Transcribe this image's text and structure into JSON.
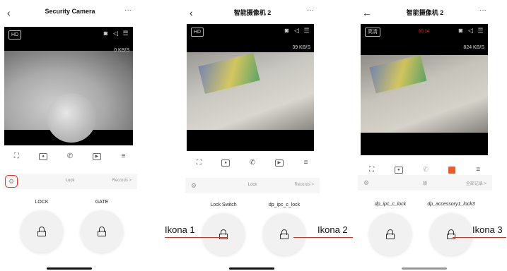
{
  "panels": [
    {
      "title": "Security Camera",
      "hd": "HD",
      "speed": "0 KB/S",
      "bar": {
        "lock": "Lock",
        "records": "Records >"
      },
      "left_button": "LOCK",
      "right_button": "GATE"
    },
    {
      "title": "智能摄像机 2",
      "hd": "HD",
      "speed": "39 KB/S",
      "bar": {
        "lock": "Lock",
        "records": "Records >"
      },
      "left_button": "Lock Switch",
      "right_button": "dp_ipc_c_lock"
    },
    {
      "title": "智能摄像机 2",
      "hd": "高清",
      "rec_time": "00:14",
      "speed": "824 KB/S",
      "bar": {
        "lock": "锁",
        "records": "全部记录 >"
      },
      "left_button": "dp_ipc_c_lock",
      "right_button": "dp_accessory1_lock3"
    }
  ],
  "annotations": {
    "ikona1": "Ikona 1",
    "ikona2": "Ikona 2",
    "ikona3": "Ikona 3"
  },
  "colors": {
    "highlight": "#e03030",
    "annotation_line": "#c0392b",
    "record_button": "#f05a28"
  }
}
